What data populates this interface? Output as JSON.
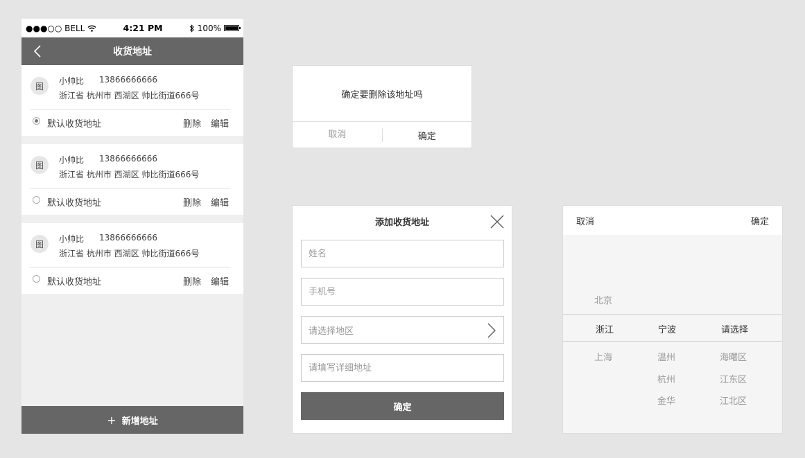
{
  "status_bar": {
    "carrier": "●●●○○ BELL",
    "time": "4:21 PM",
    "battery": "100%"
  },
  "header": {
    "title": "收货地址"
  },
  "avatar_text": "图",
  "addresses": [
    {
      "name": "小帅比",
      "phone": "13866666666",
      "address": "浙江省 杭州市 西湖区 帅比街道666号",
      "default_label": "默认收货地址",
      "delete_label": "删除",
      "edit_label": "编辑",
      "is_default": true
    },
    {
      "name": "小帅比",
      "phone": "13866666666",
      "address": "浙江省 杭州市 西湖区 帅比街道666号",
      "default_label": "默认收货地址",
      "delete_label": "删除",
      "edit_label": "编辑",
      "is_default": false
    },
    {
      "name": "小帅比",
      "phone": "13866666666",
      "address": "浙江省 杭州市 西湖区 帅比街道666号",
      "default_label": "默认收货地址",
      "delete_label": "删除",
      "edit_label": "编辑",
      "is_default": false
    }
  ],
  "add_button": {
    "icon": "+",
    "label": "新增地址"
  },
  "delete_dialog": {
    "message": "确定要删除该地址吗",
    "cancel": "取消",
    "confirm": "确定"
  },
  "add_form": {
    "title": "添加收货地址",
    "name_placeholder": "姓名",
    "phone_placeholder": "手机号",
    "region_placeholder": "请选择地区",
    "detail_placeholder": "请填写详细地址",
    "submit": "确定"
  },
  "region_picker": {
    "cancel": "取消",
    "confirm": "确定",
    "provinces_above": [
      "北京"
    ],
    "selected": [
      "浙江",
      "宁波",
      "请选择"
    ],
    "provinces_below": [
      "上海"
    ],
    "cities_below": [
      "温州",
      "杭州",
      "金华"
    ],
    "districts_below": [
      "海曙区",
      "江东区",
      "江北区"
    ]
  },
  "colors": {
    "bar": "#666666",
    "background": "#e5e5e5",
    "muted_text": "#999999"
  }
}
